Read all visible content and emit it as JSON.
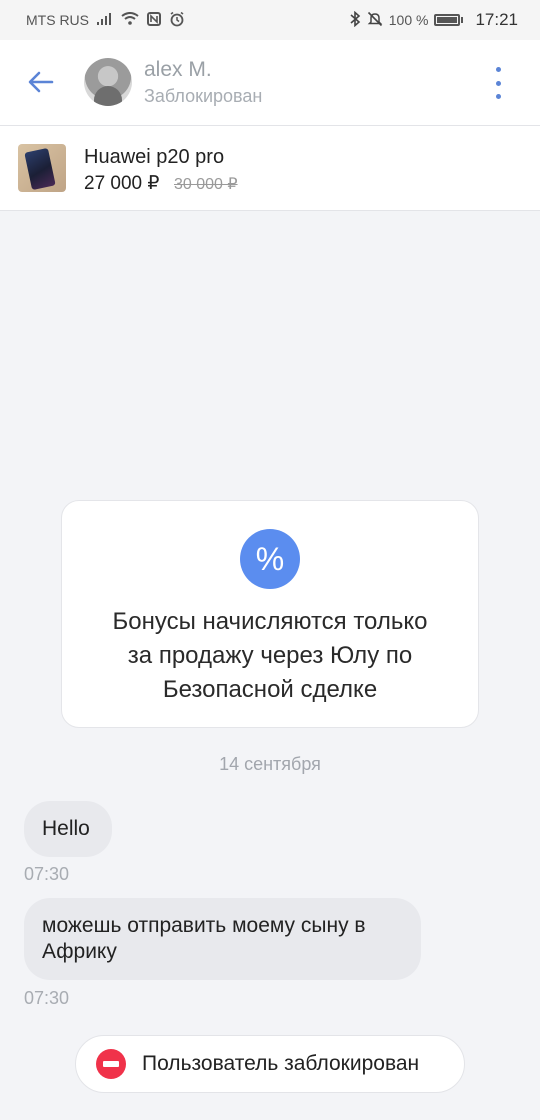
{
  "status_bar": {
    "carrier": "MTS RUS",
    "battery": "100 %",
    "time": "17:21",
    "icons": [
      "signal-icon",
      "wifi-icon",
      "nfc-icon",
      "alarm-icon",
      "bluetooth-icon",
      "mute-icon",
      "battery-icon"
    ]
  },
  "header": {
    "user_name": "alex M.",
    "user_status": "Заблокирован",
    "accent": "#5b84d6"
  },
  "product": {
    "title": "Huawei p20 pro",
    "price": "27 000 ₽",
    "old_price": "30 000 ₽"
  },
  "bonus_card": {
    "icon_symbol": "%",
    "text": "Бонусы начисляются только\nза продажу через Юлу по\nБезопасной сделке"
  },
  "chat": {
    "date_separator": "14 сентября",
    "messages": [
      {
        "text": "Hello",
        "time": "07:30"
      },
      {
        "text": "можешь отправить моему сыну в Африку",
        "time": "07:30"
      }
    ]
  },
  "footer": {
    "blocked_label": "Пользователь заблокирован",
    "block_color": "#f0324a"
  }
}
